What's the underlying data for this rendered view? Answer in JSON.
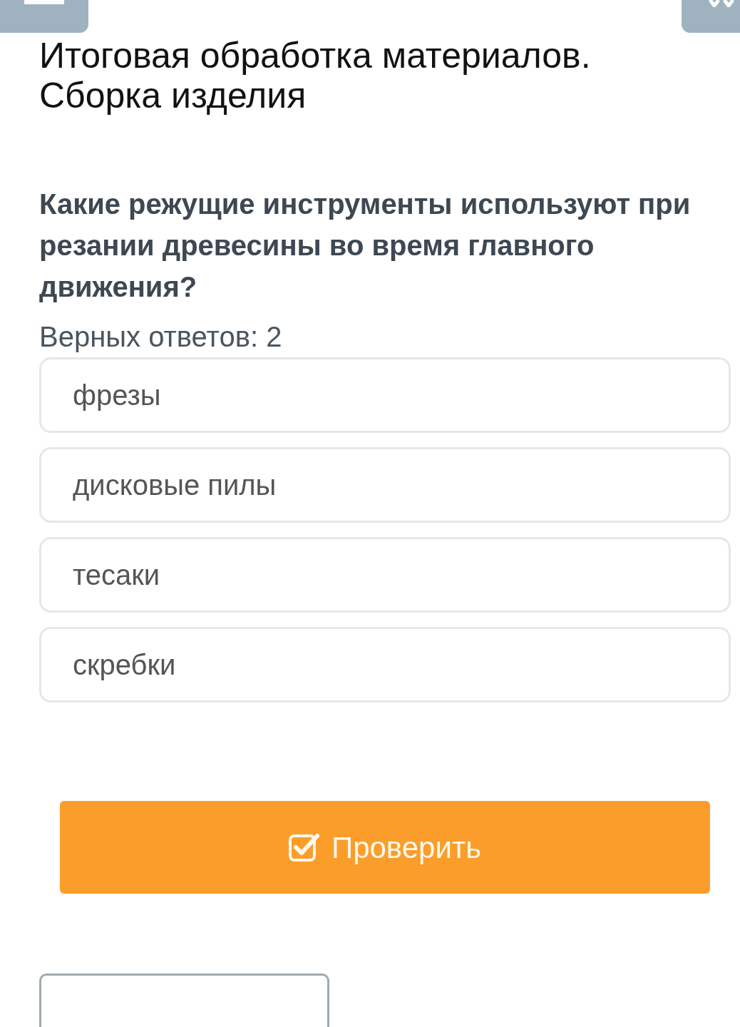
{
  "title": "Итоговая обработка материалов. Сборка изделия",
  "question": "Какие режущие инструменты используют при резании древесины во время главного движения?",
  "answer_count": "Верных ответов: 2",
  "options": [
    {
      "label": "фрезы",
      "selected": false
    },
    {
      "label": "дисковые пилы",
      "selected": false
    },
    {
      "label": "тесаки",
      "selected": false
    },
    {
      "label": "скребки",
      "selected": false
    }
  ],
  "check_button": {
    "label": "Проверить"
  }
}
